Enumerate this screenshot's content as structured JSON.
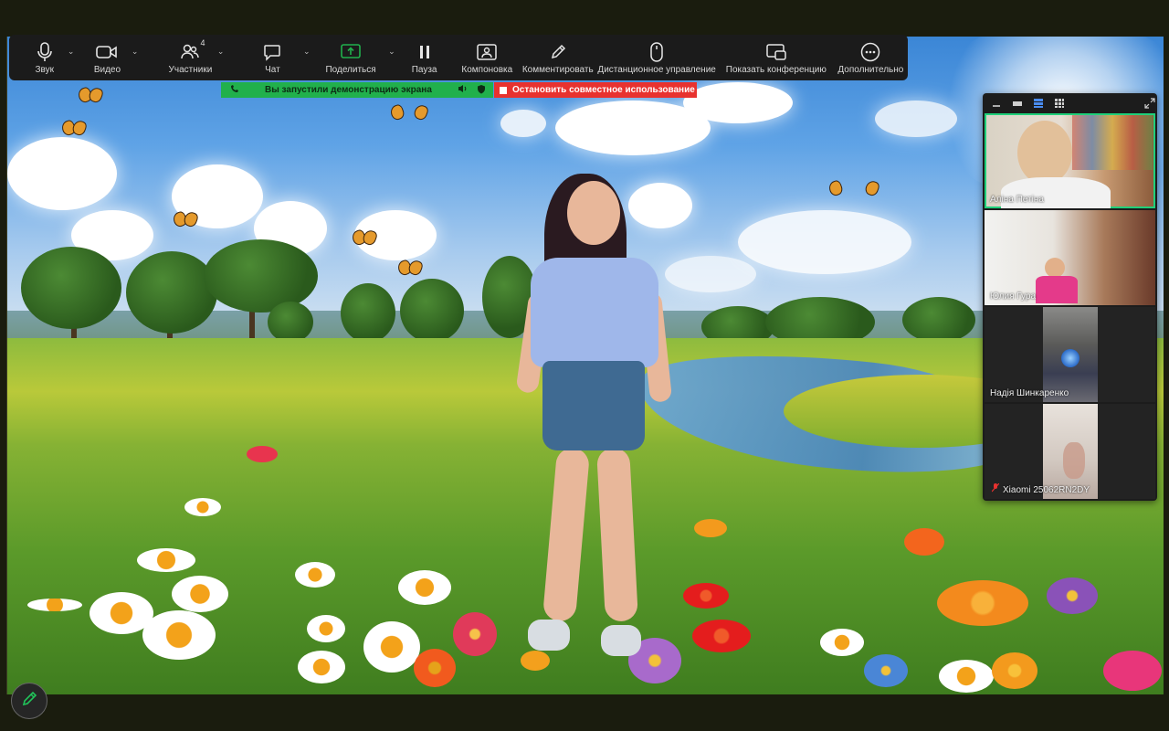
{
  "toolbar": {
    "items": [
      {
        "label": "Звук",
        "icon": "microphone-icon",
        "caret": "⌄"
      },
      {
        "label": "Видео",
        "icon": "video-camera-icon",
        "caret": "⌄"
      },
      {
        "label": "Участники",
        "icon": "participants-icon",
        "count": "4",
        "caret": "⌄"
      },
      {
        "label": "Чат",
        "icon": "chat-icon",
        "caret": "⌄"
      },
      {
        "label": "Поделиться",
        "icon": "share-screen-icon",
        "caret": "⌄"
      },
      {
        "label": "Пауза",
        "icon": "pause-icon"
      },
      {
        "label": "Компоновка",
        "icon": "layout-icon"
      },
      {
        "label": "Комментировать",
        "icon": "annotate-pen-icon"
      },
      {
        "label": "Дистанционное управление",
        "icon": "remote-control-mouse-icon"
      },
      {
        "label": "Показать конференцию",
        "icon": "show-meeting-icon"
      },
      {
        "label": "Дополнительно",
        "icon": "more-icon"
      }
    ]
  },
  "share_banner": {
    "status_text": "Вы запустили демонстрацию экрана",
    "stop_text": "Остановить совместное использование",
    "status_color": "#21b04c",
    "stop_color": "#e8322f"
  },
  "participants": [
    {
      "name": "Аліна Петіна",
      "active_speaker": true
    },
    {
      "name": "Юлия Гура",
      "active_speaker": false
    },
    {
      "name": "Надія Шинкаренко",
      "active_speaker": false
    },
    {
      "name": "Xiaomi 25062RN2DY",
      "active_speaker": false,
      "muted": true
    }
  ],
  "colors": {
    "toolbar_bg": "#1b1b1b",
    "active_speaker_border": "#1fd07a",
    "share_accent": "#21b04c"
  }
}
